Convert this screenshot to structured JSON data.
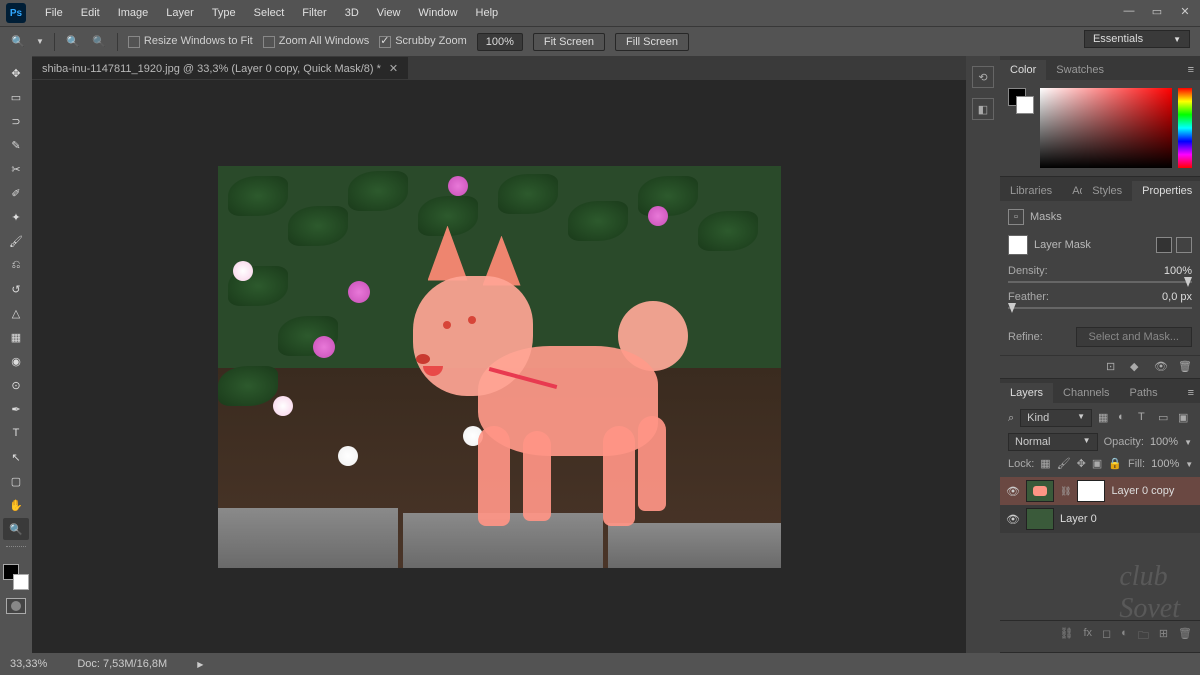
{
  "menu": [
    "File",
    "Edit",
    "Image",
    "Layer",
    "Type",
    "Select",
    "Filter",
    "3D",
    "View",
    "Window",
    "Help"
  ],
  "options": {
    "resize_label": "Resize Windows to Fit",
    "zoom_all_label": "Zoom All Windows",
    "scrubby_label": "Scrubby Zoom",
    "zoom_value": "100%",
    "fit_label": "Fit Screen",
    "fill_label": "Fill Screen"
  },
  "workspace": "Essentials",
  "document": {
    "tab_title": "shiba-inu-1147811_1920.jpg @ 33,3% (Layer 0 copy, Quick Mask/8) *",
    "zoom": "33,33%",
    "doc_info": "Doc: 7,53M/16,8M"
  },
  "panels": {
    "color_tabs": [
      "Color",
      "Swatches"
    ],
    "prop_tabs": [
      "Libraries",
      "Adjustments",
      "Styles",
      "Properties"
    ],
    "properties": {
      "title": "Masks",
      "mask_label": "Layer Mask",
      "density_label": "Density:",
      "density_value": "100%",
      "feather_label": "Feather:",
      "feather_value": "0,0 px",
      "refine_label": "Refine:",
      "refine_button": "Select and Mask..."
    },
    "layers_tabs": [
      "Layers",
      "Channels",
      "Paths"
    ],
    "layers": {
      "kind": "Kind",
      "blend": "Normal",
      "opacity_label": "Opacity:",
      "opacity_value": "100%",
      "lock_label": "Lock:",
      "fill_label": "Fill:",
      "fill_value": "100%",
      "items": [
        {
          "name": "Layer 0 copy",
          "selected": true,
          "has_mask": true
        },
        {
          "name": "Layer 0",
          "selected": false,
          "has_mask": false
        }
      ]
    }
  }
}
